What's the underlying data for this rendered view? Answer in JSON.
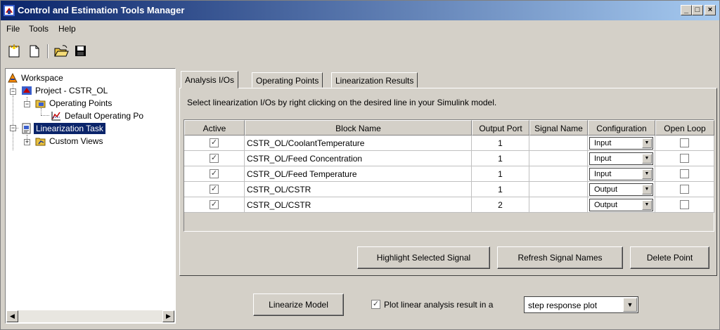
{
  "window": {
    "title": "Control and Estimation Tools Manager",
    "min_glyph": "_",
    "max_glyph": "□",
    "close_glyph": "×"
  },
  "menu": [
    "File",
    "Tools",
    "Help"
  ],
  "toolbar": {
    "icons": [
      "new-task-icon",
      "new-document-icon",
      "open-folder-icon",
      "save-icon"
    ]
  },
  "tree": {
    "nodes": [
      {
        "label": "Workspace",
        "icon": "workspace-icon"
      },
      {
        "label": "Project - CSTR_OL",
        "icon": "simulink-project-icon"
      },
      {
        "label": "Operating Points",
        "icon": "folder-icon"
      },
      {
        "label": "Default Operating Po",
        "icon": "operating-point-icon"
      },
      {
        "label": "Linearization Task",
        "icon": "linearization-task-icon",
        "selected": true
      },
      {
        "label": "Custom Views",
        "icon": "custom-views-folder-icon"
      }
    ]
  },
  "tabs": [
    "Analysis I/Os",
    "Operating Points",
    "Linearization Results"
  ],
  "instruction": "Select linearization I/Os by right clicking on the desired line in your Simulink model.",
  "table": {
    "headers": [
      "Active",
      "Block Name",
      "Output Port",
      "Signal Name",
      "Configuration",
      "Open Loop"
    ],
    "rows": [
      {
        "active": "✓",
        "block": "CSTR_OL/CoolantTemperature",
        "port": "1",
        "signal": "",
        "config": "Input",
        "open_loop": ""
      },
      {
        "active": "✓",
        "block": "CSTR_OL/Feed Concentration",
        "port": "1",
        "signal": "",
        "config": "Input",
        "open_loop": ""
      },
      {
        "active": "✓",
        "block": "CSTR_OL/Feed Temperature",
        "port": "1",
        "signal": "",
        "config": "Input",
        "open_loop": ""
      },
      {
        "active": "✓",
        "block": "CSTR_OL/CSTR",
        "port": "1",
        "signal": "",
        "config": "Output",
        "open_loop": ""
      },
      {
        "active": "✓",
        "block": "CSTR_OL/CSTR",
        "port": "2",
        "signal": "",
        "config": "Output",
        "open_loop": ""
      }
    ]
  },
  "buttons": {
    "highlight": "Highlight Selected Signal",
    "refresh": "Refresh Signal Names",
    "delete": "Delete Point",
    "linearize": "Linearize Model"
  },
  "plot_option": {
    "checked": "✓",
    "label": "Plot linear analysis result in a",
    "selected": "step response plot"
  },
  "colors": {
    "title_start": "#0a246a",
    "title_end": "#a6caf0",
    "selection": "#0a246a",
    "face": "#d4d0c8"
  }
}
